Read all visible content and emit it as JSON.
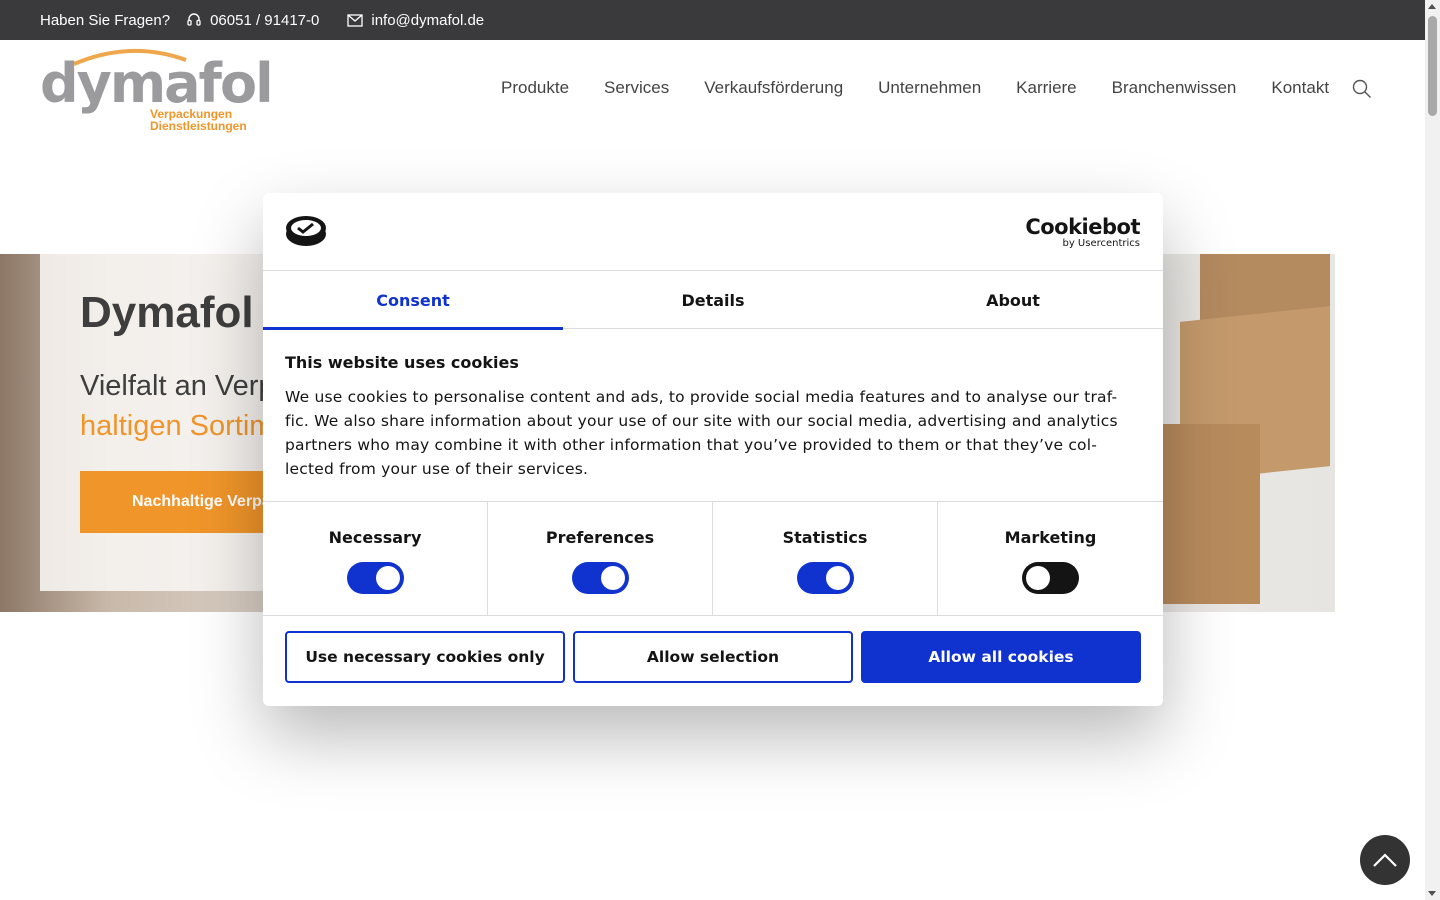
{
  "topbar": {
    "question": "Haben Sie Fragen?",
    "phone": "06051 / 91417-0",
    "email": "info@dymafol.de"
  },
  "logo": {
    "name": "dymafol",
    "tagline1": "Verpackungen",
    "tagline2": "Dienstleistungen"
  },
  "nav": {
    "items": [
      "Produkte",
      "Services",
      "Verkaufsförderung",
      "Unternehmen",
      "Karriere",
      "Branchenwissen",
      "Kontakt"
    ]
  },
  "hero": {
    "title": "Dymafol",
    "subtitle_line1": "Vielfalt an Verp",
    "subtitle_line2": "haltigen Sortim",
    "button": "Nachhaltige Verpa"
  },
  "cookie_dialog": {
    "brand": "Cookiebot",
    "brand_sub": "by Usercentrics",
    "tabs": [
      "Consent",
      "Details",
      "About"
    ],
    "heading": "This website uses cookies",
    "text": "We use cookies to personalise content and ads, to provide social media features and to analyse our traf-fic. We also share information about your use of our site with our social media, advertising and analytics partners who may combine it with other information that you’ve provided to them or that they’ve col-lected from your use of their services.",
    "categories": [
      {
        "label": "Necessary",
        "enabled": true
      },
      {
        "label": "Preferences",
        "enabled": true
      },
      {
        "label": "Statistics",
        "enabled": true
      },
      {
        "label": "Marketing",
        "enabled": false
      }
    ],
    "buttons": {
      "necessary_only": "Use necessary cookies only",
      "allow_selection": "Allow selection",
      "allow_all": "Allow all cookies"
    }
  },
  "colors": {
    "topbar": "#3a393b",
    "orange": "#f0952a",
    "cookiebot_blue": "#1032cf"
  }
}
